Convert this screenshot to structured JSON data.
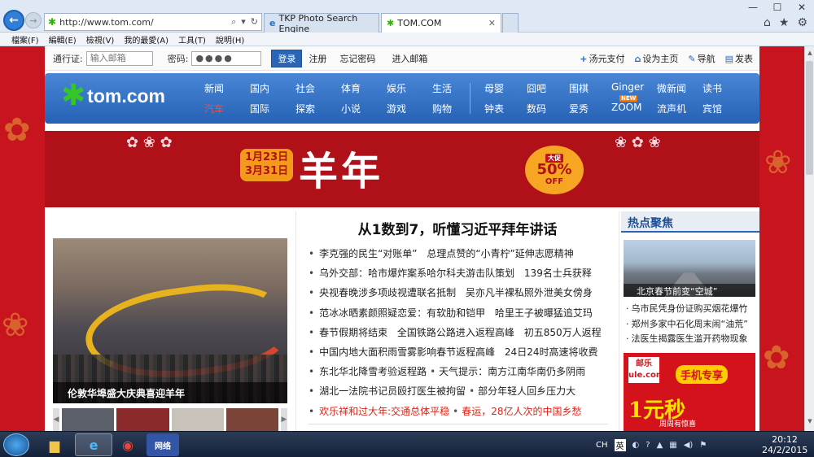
{
  "browser": {
    "address": "http://www.tom.com/",
    "tabs": [
      {
        "label": "TKP Photo Search Engine"
      },
      {
        "label": "TOM.COM"
      }
    ],
    "menu": [
      "檔案(F)",
      "編輯(E)",
      "檢視(V)",
      "我的最愛(A)",
      "工具(T)",
      "說明(H)"
    ]
  },
  "login": {
    "account_label": "通行证:",
    "account_placeholder": "输入邮箱",
    "password_label": "密码:",
    "password_value": "●●●●",
    "login_button": "登录",
    "register": "注册",
    "forgot": "忘记密码",
    "enter_mail": "进入邮箱",
    "right_links": [
      "汤元支付",
      "设为主页",
      "导航",
      "发表"
    ]
  },
  "logo": {
    "word": "tom.com"
  },
  "nav": {
    "group1": [
      [
        "新闻",
        "国内",
        "社会",
        "体育",
        "娱乐",
        "生活"
      ],
      [
        "汽车",
        "国际",
        "探索",
        "小说",
        "游戏",
        "购物"
      ]
    ],
    "group2": [
      [
        "母婴",
        "囧吧",
        "围棋",
        "Ginger",
        "微新闻",
        "读书"
      ],
      [
        "钟表",
        "数码",
        "爱秀",
        "ZOOM",
        "流声机",
        "宾馆"
      ]
    ],
    "new_badge": "NEW"
  },
  "banner": {
    "date_line1": "1月23日",
    "date_line2": "3月31日",
    "title": "羊年",
    "sale_tag": "大促",
    "sale_pct": "50%",
    "sale_off": "OFF"
  },
  "left": {
    "caption": "伦敦华埠盛大庆典喜迎羊年"
  },
  "middle": {
    "headline": "从1数到7，听懂习近平拜年讲话",
    "items": [
      [
        "李克强的民生“对账单”",
        "总理点赞的“小青柠”延伸志愿精神"
      ],
      [
        "乌外交部：哈市爆炸案系哈尔科夫游击队策划",
        "139名士兵获释"
      ],
      [
        "央视春晚涉多项歧视遭联名抵制",
        "吴亦凡半裸私照外泄美女傍身"
      ],
      [
        "范冰冰晒素颜照疑恋爱：有软肋和铠甲",
        "哈里王子被曝猛追艾玛"
      ],
      [
        "春节假期将结束",
        "全国铁路公路进入返程高峰",
        "初五850万人返程"
      ],
      [
        "中国内地大面积雨雪雾影响春节返程高峰",
        "24日24时高速将收费"
      ],
      [
        "东北华北降雪考验返程路",
        "天气提示：南方江南华南仍多阴雨"
      ],
      [
        "湖北一法院书记员殴打医生被拘留",
        "部分年轻人回乡压力大"
      ],
      [
        "欢乐祥和过大年:交通总体平稳",
        "春运，28亿人次的中国乡愁"
      ]
    ]
  },
  "right": {
    "title": "热点聚焦",
    "image_caption": "北京春节前变“空城”",
    "items": [
      "乌市民凭身份证购买烟花爆竹",
      "郑州多家中石化周末闹“油荒”",
      "法医生揭露医生滥开药物现象"
    ],
    "ad_brand": "邮乐\nule.com",
    "ad_slogan": "手机专享",
    "ad_big": "1元秒",
    "ad_sub": "周周有惊喜"
  },
  "taskbar": {
    "ime_lang": "CH",
    "ime_mode": "英",
    "clock_time": "20:12",
    "clock_date": "24/2/2015",
    "wl_label": "网络"
  }
}
